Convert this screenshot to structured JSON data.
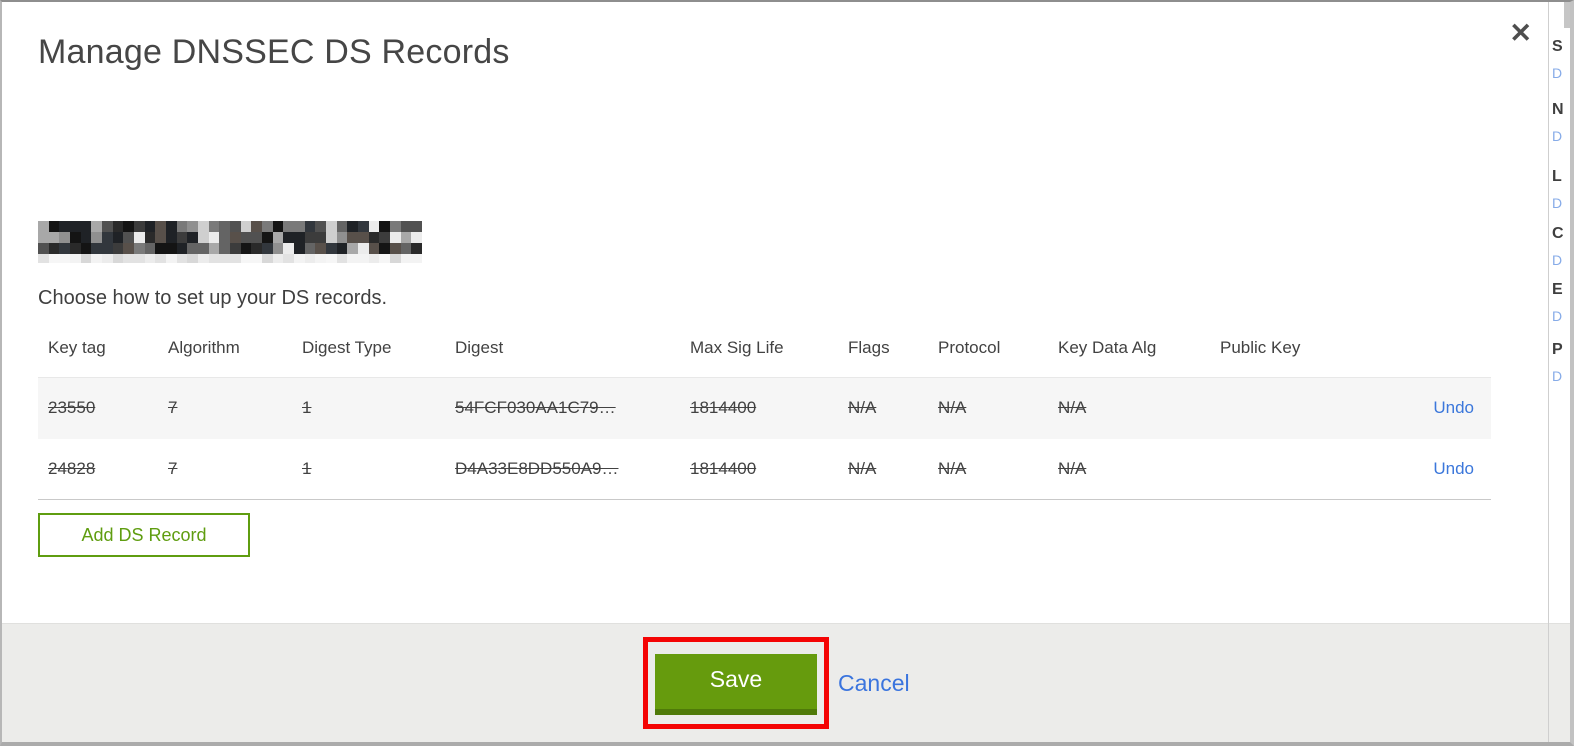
{
  "modal": {
    "title": "Manage DNSSEC DS Records",
    "close_label": "✕",
    "subtitle": "Choose how to set up your DS records.",
    "domain_name_redacted": true,
    "table": {
      "columns": [
        "Key tag",
        "Algorithm",
        "Digest Type",
        "Digest",
        "Max Sig Life",
        "Flags",
        "Protocol",
        "Key Data Alg",
        "Public Key"
      ],
      "rows": [
        {
          "key_tag": "23550",
          "algorithm": "7",
          "digest_type": "1",
          "digest": "54FCF030AA1C79…",
          "max_sig_life": "1814400",
          "flags": "N/A",
          "protocol": "N/A",
          "key_data_alg": "N/A",
          "public_key": "",
          "action": "Undo",
          "marked_for_deletion": true
        },
        {
          "key_tag": "24828",
          "algorithm": "7",
          "digest_type": "1",
          "digest": "D4A33E8DD550A9…",
          "max_sig_life": "1814400",
          "flags": "N/A",
          "protocol": "N/A",
          "key_data_alg": "N/A",
          "public_key": "",
          "action": "Undo",
          "marked_for_deletion": true
        }
      ]
    },
    "add_button_label": "Add DS Record",
    "footer": {
      "save_label": "Save",
      "cancel_label": "Cancel"
    }
  },
  "annotation": {
    "type": "highlight-rectangle",
    "target": "save-button",
    "color": "#f40404"
  },
  "background_page": {
    "fragments": [
      {
        "heading": "S",
        "link": "D"
      },
      {
        "heading": "N",
        "link": "D"
      },
      {
        "heading": "L",
        "link": "D"
      },
      {
        "heading": "C",
        "link": "D"
      },
      {
        "heading": "E",
        "link": "D"
      },
      {
        "heading": "P",
        "link": "D"
      }
    ]
  },
  "colors": {
    "accent_green": "#669b0d",
    "accent_green_dark": "#4f7a09",
    "outline_green": "#5f9d10",
    "link_blue": "#3b77db",
    "annotation_red": "#f40404",
    "footer_gray": "#ececea",
    "row_stripe_gray": "#f6f6f6",
    "text_dark": "#424242"
  }
}
